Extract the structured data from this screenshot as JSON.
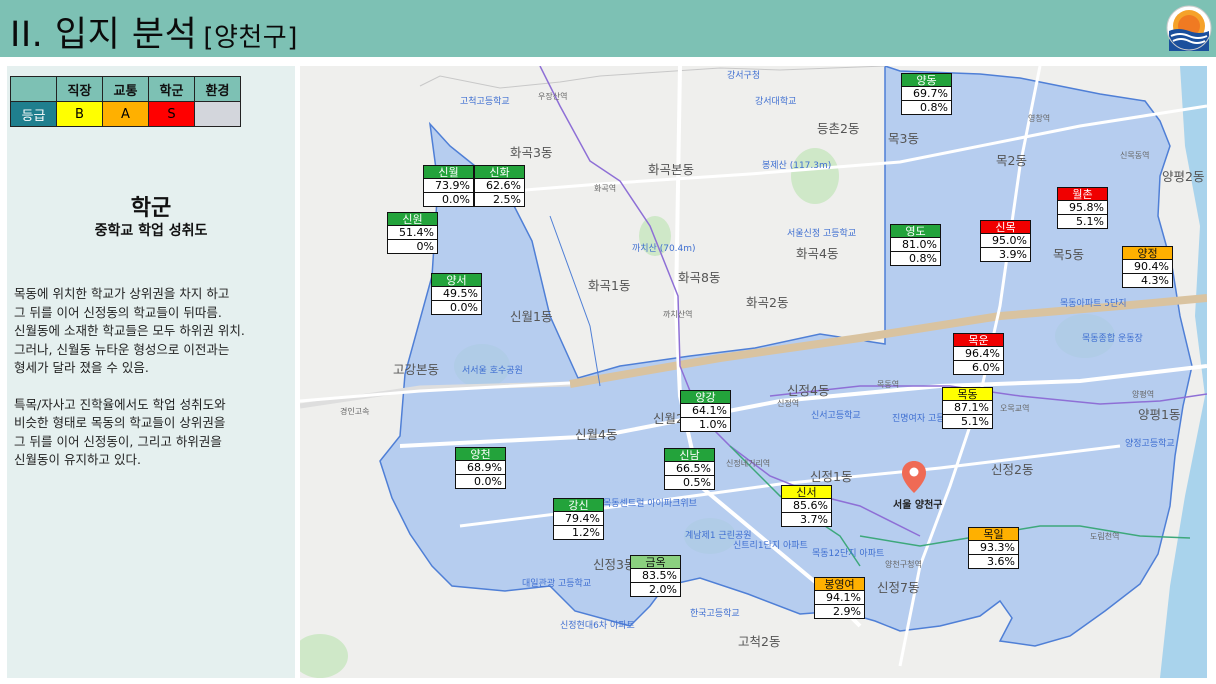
{
  "header": {
    "title": "II. 입지 분석",
    "subtitle": "[양천구]"
  },
  "grade_table": {
    "columns": [
      "직장",
      "교통",
      "학군",
      "환경"
    ],
    "row_label": "등급",
    "grades": [
      "B",
      "A",
      "S",
      ""
    ]
  },
  "panel": {
    "title": "학군",
    "subtitle": "중학교 학업 성취도",
    "paragraphs": [
      [
        "목동에 위치한 학교가 상위권을 차지 하고",
        "그 뒤를 이어 신정동의 학교들이 뒤따름.",
        "신월동에 소재한 학교들은 모두 하위권 위치.",
        "그러나, 신월동 뉴타운 형성으로 이전과는",
        "형세가 달라 졌을 수 있음."
      ],
      [
        "특목/자사고 진학율에서도 학업 성취도와",
        "비슷한 형태로 목동의 학교들이 상위권을",
        "그 뒤를 이어 신정동이, 그리고 하위권을",
        "신월동이 유지하고 있다."
      ]
    ]
  },
  "map": {
    "pin_label": "서울 양천구",
    "places": [
      {
        "text": "화곡본동",
        "big": true
      },
      {
        "text": "화곡1동",
        "big": true
      },
      {
        "text": "화곡8동",
        "big": true
      },
      {
        "text": "화곡2동",
        "big": true
      },
      {
        "text": "화곡4동",
        "big": true
      },
      {
        "text": "화곡3동",
        "big": true
      },
      {
        "text": "등촌2동",
        "big": true
      },
      {
        "text": "목2동",
        "big": true
      },
      {
        "text": "목3동",
        "big": true
      },
      {
        "text": "목5동",
        "big": true
      },
      {
        "text": "신월1동",
        "big": true
      },
      {
        "text": "신월4동",
        "big": true
      },
      {
        "text": "신월2",
        "big": true
      },
      {
        "text": "신정4동",
        "big": true
      },
      {
        "text": "신정1동",
        "big": true
      },
      {
        "text": "신정2동",
        "big": true
      },
      {
        "text": "신정3동",
        "big": true
      },
      {
        "text": "신정7동",
        "big": true
      },
      {
        "text": "고강본동",
        "big": true
      },
      {
        "text": "고척2동",
        "big": true
      },
      {
        "text": "양평1동",
        "big": true
      },
      {
        "text": "양평2동",
        "big": true
      },
      {
        "text": "우장산역",
        "big": false
      },
      {
        "text": "화곡역",
        "big": false
      },
      {
        "text": "까치산역",
        "big": false
      },
      {
        "text": "신정역",
        "big": false
      },
      {
        "text": "목동역",
        "big": false
      },
      {
        "text": "오목교역",
        "big": false
      },
      {
        "text": "신정네거리역",
        "big": false
      },
      {
        "text": "양천구청역",
        "big": false
      },
      {
        "text": "도림천역",
        "big": false
      },
      {
        "text": "영창역",
        "big": false
      },
      {
        "text": "신목동역",
        "big": false
      },
      {
        "text": "양평역",
        "big": false
      },
      {
        "text": "봉제산 (117.3m)",
        "big": false
      },
      {
        "text": "까치산 (70.4m)",
        "big": false
      },
      {
        "text": "서서울 호수공원",
        "big": false
      },
      {
        "text": "계남제1 근린공원",
        "big": false
      },
      {
        "text": "경인고속",
        "big": false
      },
      {
        "text": "목동종합 운동장",
        "big": false
      },
      {
        "text": "강서구청",
        "big": false
      },
      {
        "text": "강서대학교",
        "big": false
      },
      {
        "text": "서울신정 고등학교",
        "big": false
      },
      {
        "text": "진명여자 고등학교",
        "big": false
      },
      {
        "text": "대일관광 고등학교",
        "big": false
      },
      {
        "text": "신서고등학교",
        "big": false
      },
      {
        "text": "한국고등학교",
        "big": false
      },
      {
        "text": "양정고등학교",
        "big": false
      },
      {
        "text": "고척고등학교",
        "big": false
      },
      {
        "text": "목동아파트 5단지",
        "big": false
      },
      {
        "text": "목동12단지 아파트",
        "big": false
      },
      {
        "text": "신트리1단지 아파트",
        "big": false
      },
      {
        "text": "신정현대6차 아파트",
        "big": false
      },
      {
        "text": "목동센트럴 아이파크위브",
        "big": false
      }
    ]
  },
  "markers": [
    {
      "name": "양동",
      "v1": "69.7%",
      "v2": "0.8%",
      "color": "green"
    },
    {
      "name": "신월",
      "v1": "73.9%",
      "v2": "0.0%",
      "color": "green"
    },
    {
      "name": "신화",
      "v1": "62.6%",
      "v2": "2.5%",
      "color": "green"
    },
    {
      "name": "신원",
      "v1": "51.4%",
      "v2": "0%",
      "color": "green"
    },
    {
      "name": "양서",
      "v1": "49.5%",
      "v2": "0.0%",
      "color": "green"
    },
    {
      "name": "영도",
      "v1": "81.0%",
      "v2": "0.8%",
      "color": "green"
    },
    {
      "name": "신목",
      "v1": "95.0%",
      "v2": "3.9%",
      "color": "red"
    },
    {
      "name": "월촌",
      "v1": "95.8%",
      "v2": "5.1%",
      "color": "red"
    },
    {
      "name": "양정",
      "v1": "90.4%",
      "v2": "4.3%",
      "color": "orange"
    },
    {
      "name": "목운",
      "v1": "96.4%",
      "v2": "6.0%",
      "color": "red"
    },
    {
      "name": "목동",
      "v1": "87.1%",
      "v2": "5.1%",
      "color": "yellow"
    },
    {
      "name": "양강",
      "v1": "64.1%",
      "v2": "1.0%",
      "color": "green"
    },
    {
      "name": "신남",
      "v1": "66.5%",
      "v2": "0.5%",
      "color": "green"
    },
    {
      "name": "양천",
      "v1": "68.9%",
      "v2": "0.0%",
      "color": "green"
    },
    {
      "name": "강신",
      "v1": "79.4%",
      "v2": "1.2%",
      "color": "green"
    },
    {
      "name": "신서",
      "v1": "85.6%",
      "v2": "3.7%",
      "color": "yellow"
    },
    {
      "name": "금옥",
      "v1": "83.5%",
      "v2": "2.0%",
      "color": "lightgreen"
    },
    {
      "name": "봉영여",
      "v1": "94.1%",
      "v2": "2.9%",
      "color": "orange"
    },
    {
      "name": "목일",
      "v1": "93.3%",
      "v2": "3.6%",
      "color": "orange"
    }
  ],
  "colors": {
    "header": "#7dc1b4",
    "district_fill": "#a8c4ef",
    "district_border": "#4f7fd6",
    "grade_b": "#ffff00",
    "grade_a": "#ffb000",
    "grade_s": "#ff0000"
  }
}
